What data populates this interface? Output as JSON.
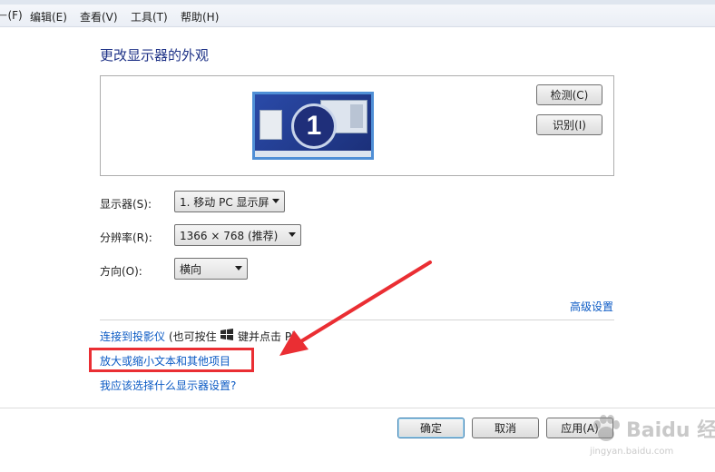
{
  "menu": {
    "file": "⊢(F)",
    "edit": "编辑(E)",
    "view": "查看(V)",
    "tools": "工具(T)",
    "help": "帮助(H)"
  },
  "page": {
    "title": "更改显示器的外观"
  },
  "preview": {
    "monitor_number": "1",
    "detect_button": "检测(C)",
    "identify_button": "识别(I)"
  },
  "settings": {
    "display_label": "显示器(S):",
    "display_value": "1. 移动 PC 显示屏",
    "resolution_label": "分辨率(R):",
    "resolution_value": "1366 × 768 (推荐)",
    "orientation_label": "方向(O):",
    "orientation_value": "横向"
  },
  "links": {
    "advanced": "高级设置",
    "projector": "连接到投影仪",
    "projector_hint_prefix": "(也可按住",
    "projector_hint_suffix": "键并点击 P)",
    "text_size": "放大或缩小文本和其他项目",
    "which_settings": "我应该选择什么显示器设置?"
  },
  "footer": {
    "ok_button": "确定",
    "cancel_button": "取消",
    "apply_button": "应用(A)"
  },
  "watermark": {
    "brand": "Baidu 经验",
    "url": "jingyan.baidu.com"
  },
  "colors": {
    "link": "#0b5ac4",
    "title": "#1e3287",
    "annotation_red": "#ea2e33"
  }
}
